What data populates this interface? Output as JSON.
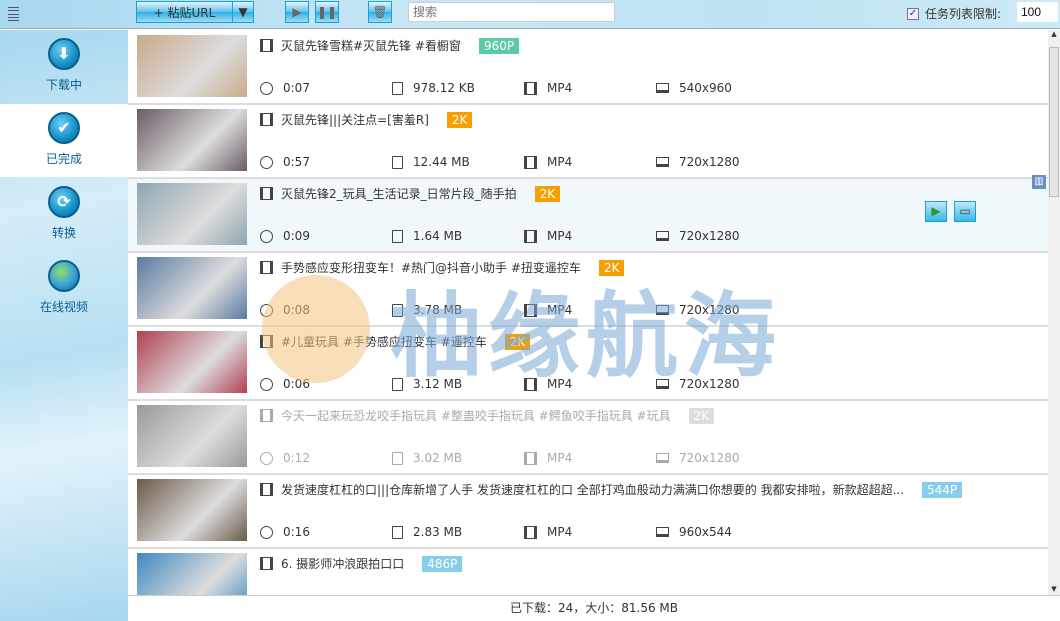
{
  "toolbar": {
    "paste_url": "+ 粘贴URL",
    "search_placeholder": "搜索",
    "limit_label": "任务列表限制:",
    "limit_value": "100",
    "limit_checked": true
  },
  "sidebar": {
    "items": [
      {
        "label": "下载中",
        "icon": "download-icon"
      },
      {
        "label": "已完成",
        "icon": "check-icon",
        "active": true
      },
      {
        "label": "转换",
        "icon": "convert-icon"
      },
      {
        "label": "在线视频",
        "icon": "globe-icon"
      }
    ]
  },
  "watermark": "柚缘航海",
  "rows": [
    {
      "title": "灭鼠先锋雪糕#灭鼠先锋 #看橱窗",
      "badge": "960P",
      "badge_color": "#5cc9a7",
      "duration": "0:07",
      "size": "978.12 KB",
      "format": "MP4",
      "resolution": "540x960",
      "thumb": "#c9a98a"
    },
    {
      "title": "灭鼠先锋|||关注点=[害羞R]",
      "badge": "2K",
      "badge_color": "#f5a000",
      "duration": "0:57",
      "size": "12.44 MB",
      "format": "MP4",
      "resolution": "720x1280",
      "thumb": "#6a5c66"
    },
    {
      "title": "灭鼠先锋2_玩具_生活记录_日常片段_随手拍",
      "badge": "2K",
      "badge_color": "#f5a000",
      "duration": "0:09",
      "size": "1.64 MB",
      "format": "MP4",
      "resolution": "720x1280",
      "thumb": "#8fa5b0",
      "selected": true
    },
    {
      "title": "手势感应变形扭变车！#热门@抖音小助手 #扭变遥控车",
      "badge": "2K",
      "badge_color": "#f5a000",
      "duration": "0:08",
      "size": "3.78 MB",
      "format": "MP4",
      "resolution": "720x1280",
      "thumb": "#5a7aa0"
    },
    {
      "title": "#儿童玩具 #手势感应扭变车 #遥控车",
      "badge": "2K",
      "badge_color": "#f5a000",
      "duration": "0:06",
      "size": "3.12 MB",
      "format": "MP4",
      "resolution": "720x1280",
      "thumb": "#b04050"
    },
    {
      "title": "今天一起来玩恐龙咬手指玩具 #整蛊咬手指玩具 #鳄鱼咬手指玩具 #玩具",
      "badge": "2K",
      "badge_color": "#dddddd",
      "duration": "0:12",
      "size": "3.02 MB",
      "format": "MP4",
      "resolution": "720x1280",
      "thumb": "#999999",
      "dim": true
    },
    {
      "title": "发货速度杠杠的口|||仓库新增了人手 发货速度杠杠的口 全部打鸡血般动力满满口你想要的 我都安排啦，新款超超超...",
      "badge": "544P",
      "badge_color": "#87ceeb",
      "duration": "0:16",
      "size": "2.83 MB",
      "format": "MP4",
      "resolution": "960x544",
      "thumb": "#6b5a48"
    },
    {
      "title": "6. 摄影师冲浪跟拍口口",
      "badge": "486P",
      "badge_color": "#87ceeb",
      "thumb": "#3f88c0"
    }
  ],
  "footer": "已下载：24，大小：81.56 MB"
}
